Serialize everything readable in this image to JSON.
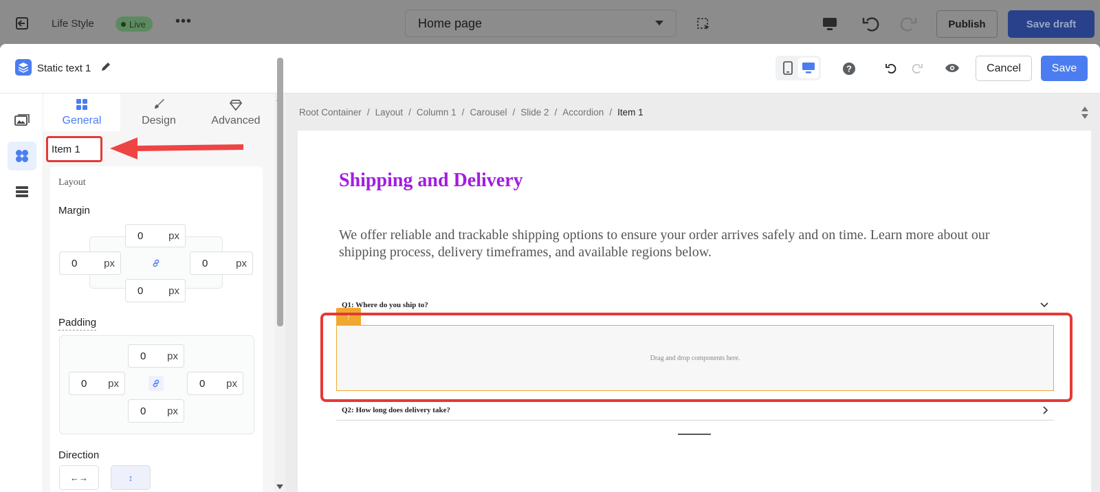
{
  "topbar": {
    "store_name": "Life Style",
    "live_label": "Live",
    "page_select": "Home page",
    "publish_label": "Publish",
    "save_draft_label": "Save draft"
  },
  "modal": {
    "title": "Static text 1",
    "cancel_label": "Cancel",
    "save_label": "Save"
  },
  "panel": {
    "tabs": [
      {
        "label": "General"
      },
      {
        "label": "Design"
      },
      {
        "label": "Advanced"
      }
    ],
    "element_name": "Item 1",
    "section_title": "Layout",
    "margin_label": "Margin",
    "padding_label": "Padding",
    "direction_label": "Direction",
    "unit": "px",
    "margin": {
      "top": "0",
      "left": "0",
      "right": "0",
      "bottom": "0"
    },
    "padding": {
      "top": "0",
      "left": "0",
      "right": "0",
      "bottom": "0"
    },
    "direction_options": [
      "←→",
      "↕"
    ]
  },
  "breadcrumb": [
    "Root Container",
    "Layout",
    "Column 1",
    "Carousel",
    "Slide 2",
    "Accordion",
    "Item 1"
  ],
  "content": {
    "heading": "Shipping and Delivery",
    "description": "We offer reliable and trackable shipping options to ensure your order arrives safely and on time. Learn more about our shipping process, delivery timeframes, and available regions below.",
    "accordion": [
      {
        "question": "Q1: Where do you ship to?"
      },
      {
        "question": "Q2: How long does delivery take?"
      }
    ],
    "drop_zone_text": "Drag and drop components here.",
    "tag_symbol": "↑"
  },
  "colors": {
    "accent": "#4b7df0",
    "heading": "#a21ce0",
    "highlight": "#e53935",
    "selection": "#f0a830"
  }
}
